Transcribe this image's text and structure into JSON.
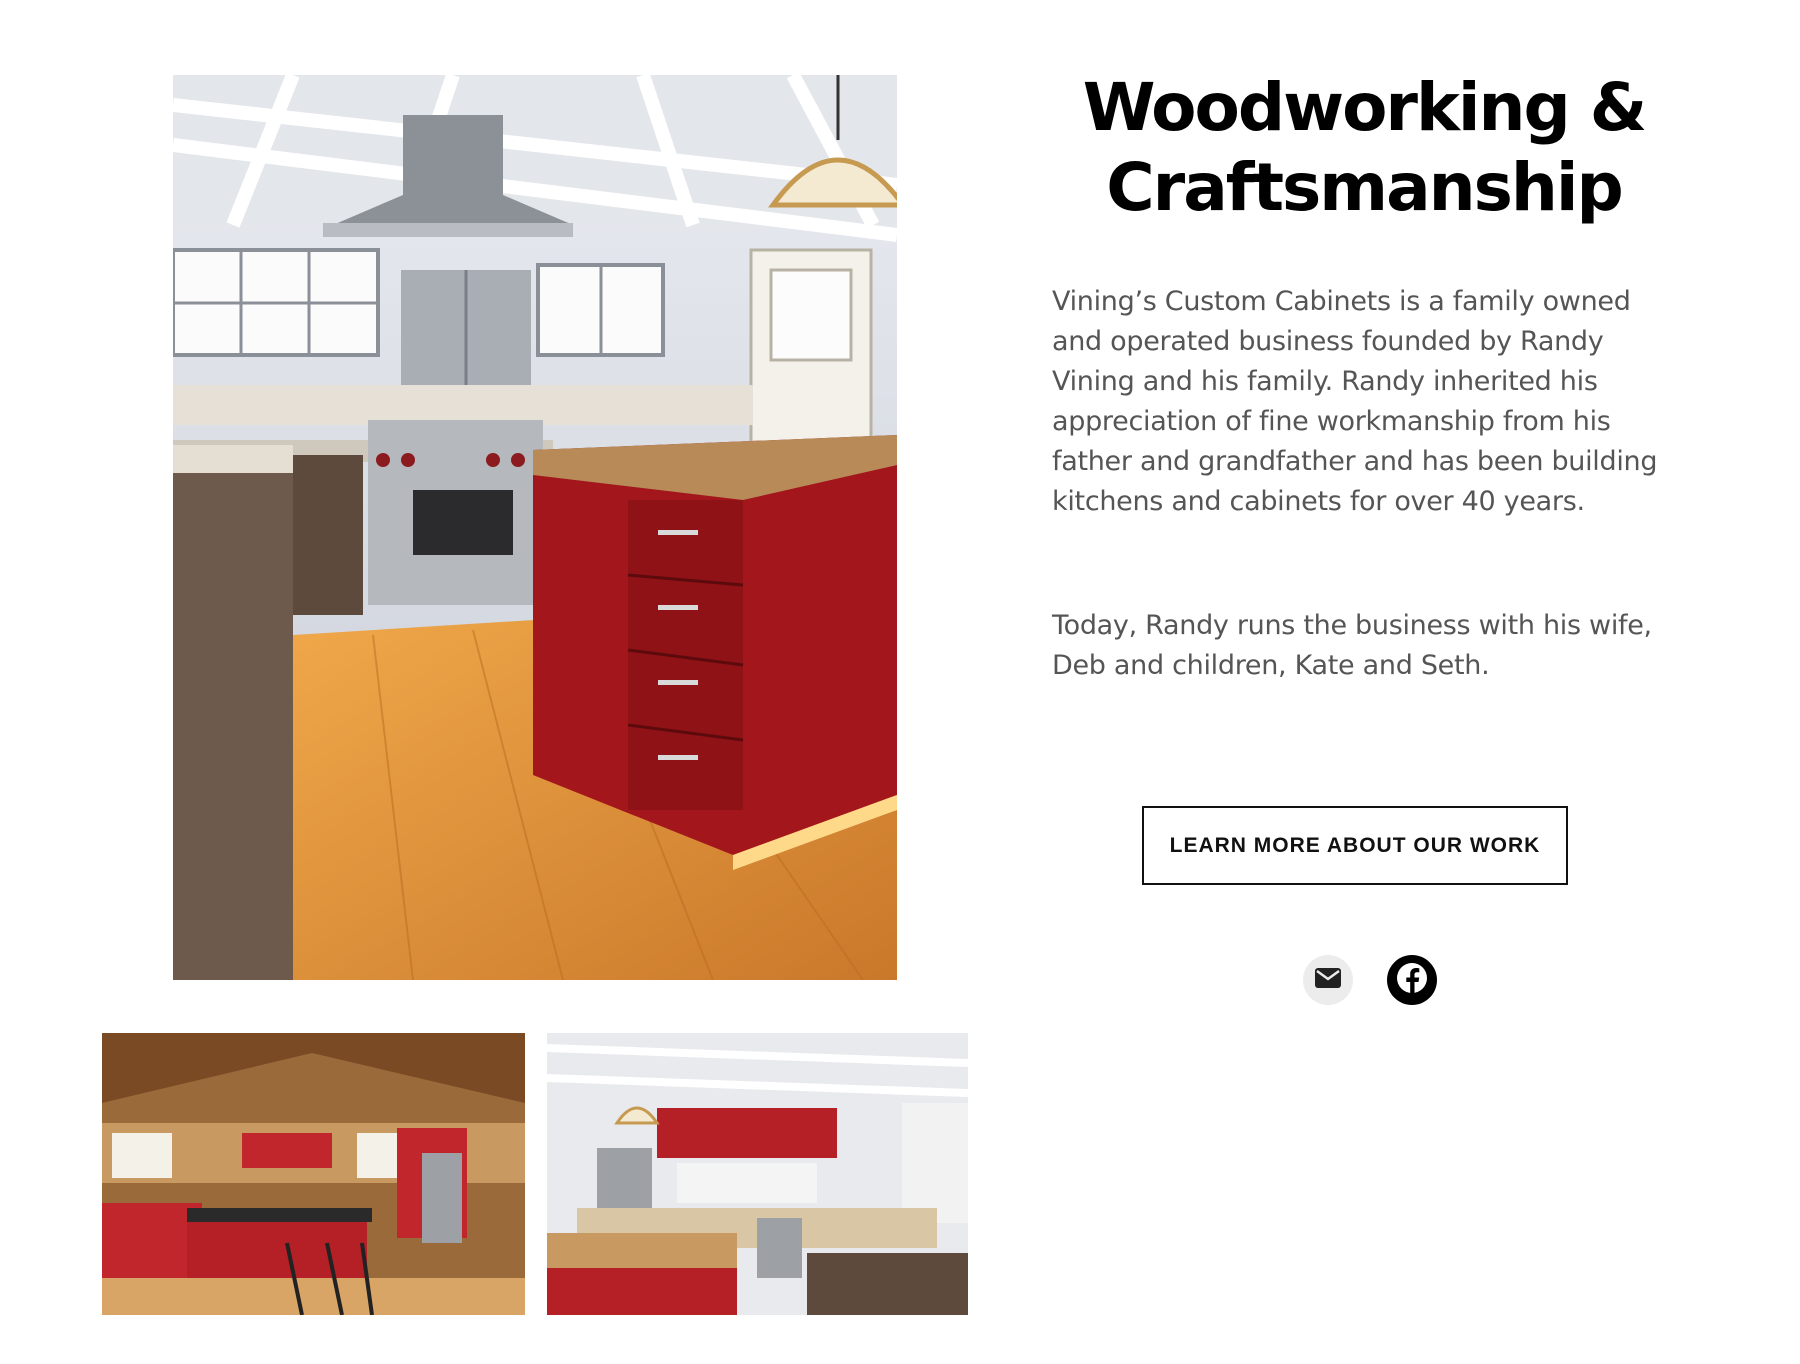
{
  "section": {
    "title": "Woodworking & Craftsmanship",
    "paragraphs": [
      "Vining’s Custom Cabinets is a family owned and operated business founded by Randy Vining and his family. Randy inherited his appreciation of fine workmanship from his father and grandfather and has been building kitchens and cabinets for over 40 years.",
      "Today, Randy runs the business with his wife, Deb and children, Kate and Seth."
    ],
    "cta_label": "LEARN MORE ABOUT OUR WORK"
  },
  "social": [
    {
      "icon": "mail-icon"
    },
    {
      "icon": "facebook-icon"
    }
  ],
  "colors": {
    "title": "#000000",
    "body_text": "#555555",
    "cabinet_red": "#a3161c",
    "wood_floor": "#d8892f"
  }
}
